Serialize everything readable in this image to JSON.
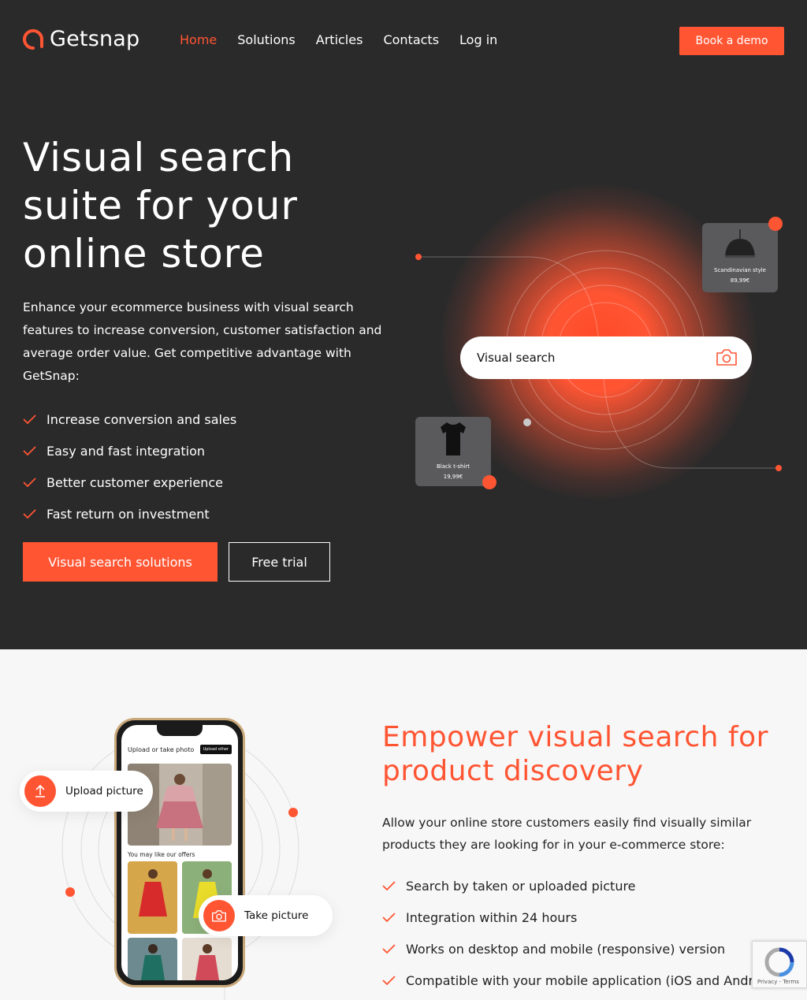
{
  "header": {
    "logo_text": "Getsnap",
    "nav": [
      {
        "label": "Home",
        "active": true
      },
      {
        "label": "Solutions",
        "active": false
      },
      {
        "label": "Articles",
        "active": false
      },
      {
        "label": "Contacts",
        "active": false
      },
      {
        "label": "Log in",
        "active": false
      }
    ],
    "demo_button": "Book a demo"
  },
  "hero": {
    "title": "Visual search suite for your online store",
    "description": "Enhance your ecommerce business with visual search features to increase conversion, customer satisfaction and average order value. Get competitive advantage with GetSnap:",
    "features": [
      "Increase conversion and sales",
      "Easy and fast integration",
      "Better customer experience",
      "Fast return on investment"
    ],
    "primary_button": "Visual search solutions",
    "secondary_button": "Free trial",
    "visual": {
      "search_label": "Visual search",
      "products": [
        {
          "name": "Scandinavian style",
          "price": "89,99€"
        },
        {
          "name": "Black t-shirt",
          "price": "19,99€"
        }
      ]
    }
  },
  "section2": {
    "title": "Empower visual search for product discovery",
    "description": "Allow your online store customers easily find visually similar products they are looking for in your e-commerce store:",
    "features": [
      "Search by taken or uploaded picture",
      "Integration within 24 hours",
      "Works on desktop and mobile (responsive) version",
      "Compatible with your mobile application (iOS and Android)"
    ],
    "phone": {
      "header": "Upload or take photo",
      "header_button": "Upload other",
      "subheader": "You may like our offers"
    },
    "upload_pill": "Upload picture",
    "take_pill": "Take picture"
  },
  "recaptcha": {
    "text": "Privacy - Terms"
  },
  "colors": {
    "accent": "#ff5533",
    "dark_bg": "#2a2a2b",
    "light_bg": "#f7f7f7"
  }
}
